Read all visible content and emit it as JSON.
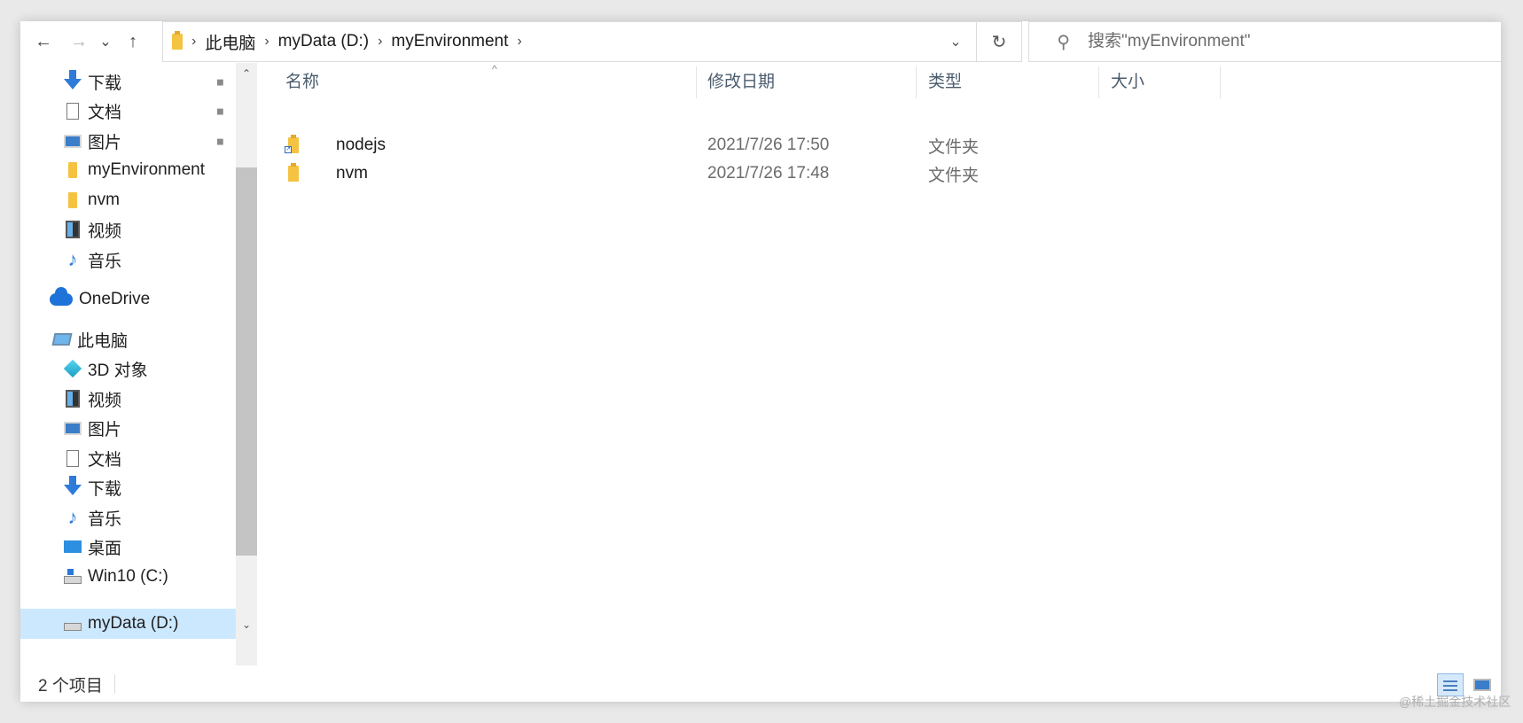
{
  "toolbar": {
    "back": "←",
    "forward": "→",
    "recent": "⌄",
    "up": "↑"
  },
  "address": {
    "crumbs": [
      "此电脑",
      "myData (D:)",
      "myEnvironment"
    ],
    "dropdown": "⌄",
    "refresh": "↻"
  },
  "search": {
    "placeholder": "搜索\"myEnvironment\""
  },
  "nav": {
    "quick_access": [
      {
        "label": "下载",
        "icon": "download-icon",
        "pinned": true
      },
      {
        "label": "文档",
        "icon": "document-icon",
        "pinned": true
      },
      {
        "label": "图片",
        "icon": "pictures-icon",
        "pinned": true
      },
      {
        "label": "myEnvironment",
        "icon": "folder-icon",
        "pinned": false
      },
      {
        "label": "nvm",
        "icon": "folder-icon",
        "pinned": false
      },
      {
        "label": "视频",
        "icon": "video-icon",
        "pinned": false
      },
      {
        "label": "音乐",
        "icon": "music-icon",
        "pinned": false
      }
    ],
    "onedrive": "OneDrive",
    "this_pc": "此电脑",
    "pc_items": [
      {
        "label": "3D 对象",
        "icon": "3d-objects-icon"
      },
      {
        "label": "视频",
        "icon": "video-icon"
      },
      {
        "label": "图片",
        "icon": "pictures-icon"
      },
      {
        "label": "文档",
        "icon": "document-icon"
      },
      {
        "label": "下载",
        "icon": "download-icon"
      },
      {
        "label": "音乐",
        "icon": "music-icon"
      },
      {
        "label": "桌面",
        "icon": "desktop-icon"
      },
      {
        "label": "Win10 (C:)",
        "icon": "system-drive-icon"
      },
      {
        "label": "myData (D:)",
        "icon": "drive-icon"
      }
    ],
    "pin_glyph": "📌",
    "scroll_up": "⌃",
    "scroll_down": "⌄"
  },
  "columns": {
    "name": "名称",
    "date": "修改日期",
    "type": "类型",
    "size": "大小",
    "sort_caret": "^"
  },
  "files": [
    {
      "name": "nodejs",
      "date": "2021/7/26 17:50",
      "type": "文件夹",
      "shortcut": true
    },
    {
      "name": "nvm",
      "date": "2021/7/26 17:48",
      "type": "文件夹",
      "shortcut": false
    }
  ],
  "status": {
    "count": "2 个项目"
  },
  "watermark": "@稀土掘金技术社区"
}
